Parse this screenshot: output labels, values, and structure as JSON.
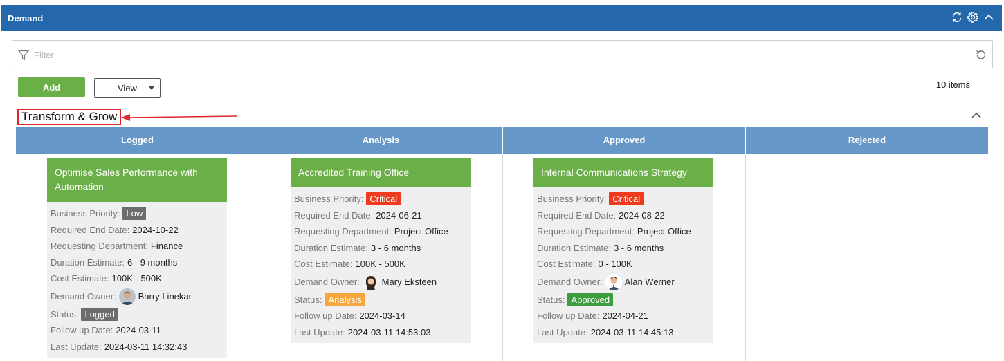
{
  "header": {
    "title": "Demand"
  },
  "filter": {
    "placeholder": "Filter",
    "value": ""
  },
  "toolbar": {
    "add_label": "Add",
    "view_label": "View",
    "items_count": "10 items"
  },
  "group": {
    "title": "Transform & Grow"
  },
  "columns": [
    {
      "label": "Logged"
    },
    {
      "label": "Analysis"
    },
    {
      "label": "Approved"
    },
    {
      "label": "Rejected"
    }
  ],
  "labels": {
    "priority": "Business Priority:",
    "end_date": "Required End Date:",
    "department": "Requesting Department:",
    "duration": "Duration Estimate:",
    "cost": "Cost Estimate:",
    "owner": "Demand Owner:",
    "status": "Status:",
    "follow_up": "Follow up Date:",
    "last_update": "Last Update:"
  },
  "cards": [
    {
      "title": "Optimise Sales Performance with Automation",
      "priority": "Low",
      "end_date": "2024-10-22",
      "department": "Finance",
      "duration": "6 - 9 months",
      "cost": "100K - 500K",
      "owner": "Barry Linekar",
      "status": "Logged",
      "follow_up": "2024-03-11",
      "last_update": "2024-03-11 14:32:43"
    },
    {
      "title": "Accredited Training Office",
      "priority": "Critical",
      "end_date": "2024-06-21",
      "department": "Project Office",
      "duration": "3 - 6 months",
      "cost": "100K - 500K",
      "owner": "Mary Eksteen",
      "status": "Analysis",
      "follow_up": "2024-03-14",
      "last_update": "2024-03-11 14:53:03"
    },
    {
      "title": "Internal Communications Strategy",
      "priority": "Critical",
      "end_date": "2024-08-22",
      "department": "Project Office",
      "duration": "3 - 6 months",
      "cost": "0 - 100K",
      "owner": "Alan Werner",
      "status": "Approved",
      "follow_up": "2024-04-21",
      "last_update": "2024-03-11 14:45:13"
    }
  ],
  "colors": {
    "header": "#2468ab",
    "column_header": "#6597c8",
    "card_title": "#6aaf47",
    "critical": "#ef3a1d",
    "analysis": "#f7a63d",
    "approved": "#3c9e3e",
    "neutral_badge": "#6d6d6d"
  },
  "icons": {
    "header": [
      "refresh-icon",
      "gear-icon",
      "chevron-up-icon"
    ],
    "filter": "filter-funnel-icon",
    "reset": "reset-icon"
  }
}
